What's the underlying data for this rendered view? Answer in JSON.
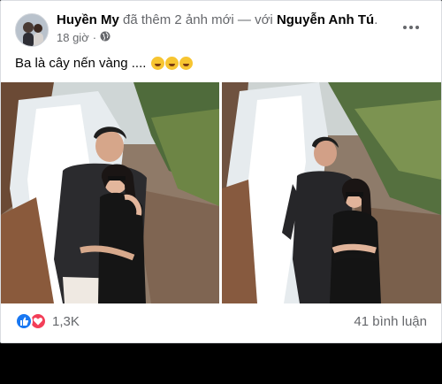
{
  "post": {
    "author": "Huyền My",
    "action": " đã thêm 2 ảnh mới — với ",
    "tagged": "Nguyễn Anh Tú",
    "tagged_suffix": ".",
    "time": "18 giờ",
    "audience_icon": "globe-icon",
    "caption": "Ba là cây nến vàng ....",
    "caption_emojis": [
      "rofl-emoji",
      "rofl-emoji",
      "rofl-emoji"
    ]
  },
  "photos": [
    {
      "name": "photo-couple-waterfall-hug"
    },
    {
      "name": "photo-couple-waterfall-standing"
    }
  ],
  "footer": {
    "reaction_icons": [
      "like-icon",
      "love-icon"
    ],
    "reaction_count": "1,3K",
    "comments": "41 bình luận"
  },
  "colors": {
    "like": "#1877f2",
    "love": "#f33e58",
    "secondary_text": "#65676b",
    "primary_text": "#050505"
  }
}
